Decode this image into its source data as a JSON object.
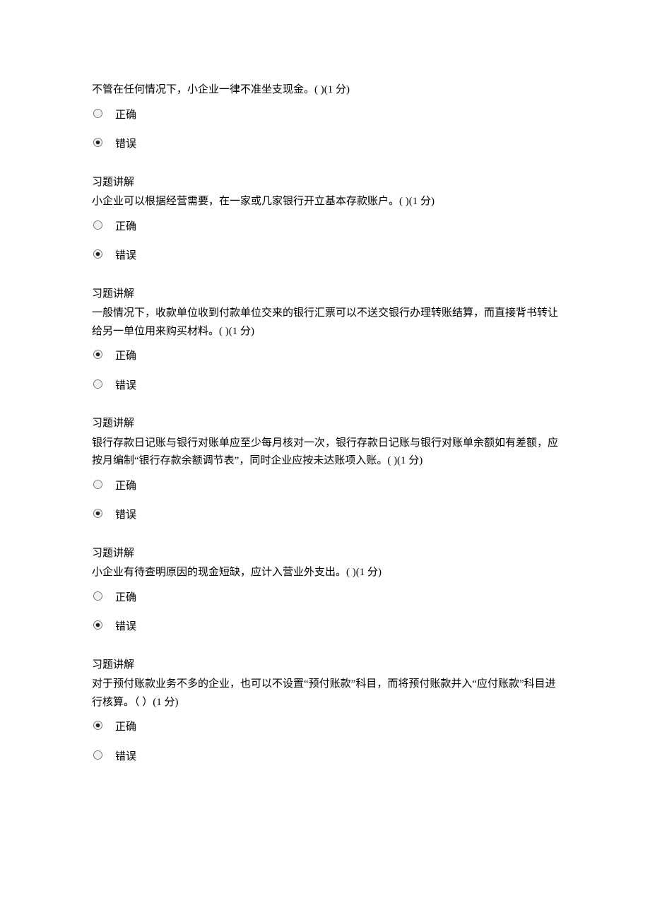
{
  "labels": {
    "correct": "正确",
    "wrong": "错误",
    "explain": "习题讲解"
  },
  "questions": [
    {
      "text": "不管在任何情况下，小企业一律不准坐支现金。( )(1 分)",
      "selected": "wrong"
    },
    {
      "text": "小企业可以根据经营需要，在一家或几家银行开立基本存款账户。( )(1 分)",
      "selected": "wrong"
    },
    {
      "text": "一般情况下，收款单位收到付款单位交来的银行汇票可以不送交银行办理转账结算，而直接背书转让给另一单位用来购买材料。( )(1 分)",
      "selected": "correct"
    },
    {
      "text": "银行存款日记账与银行对账单应至少每月核对一次，银行存款日记账与银行对账单余额如有差额，应按月编制“银行存款余额调节表”，同时企业应按未达账项入账。( )(1 分)",
      "selected": "wrong"
    },
    {
      "text": "小企业有待查明原因的现金短缺，应计入营业外支出。( )(1 分)",
      "selected": "wrong"
    },
    {
      "text": "对于预付账款业务不多的企业，也可以不设置“预付账款”科目，而将预付账款并入“应付账款”科目进行核算。（ ）(1 分)",
      "selected": "correct"
    }
  ]
}
